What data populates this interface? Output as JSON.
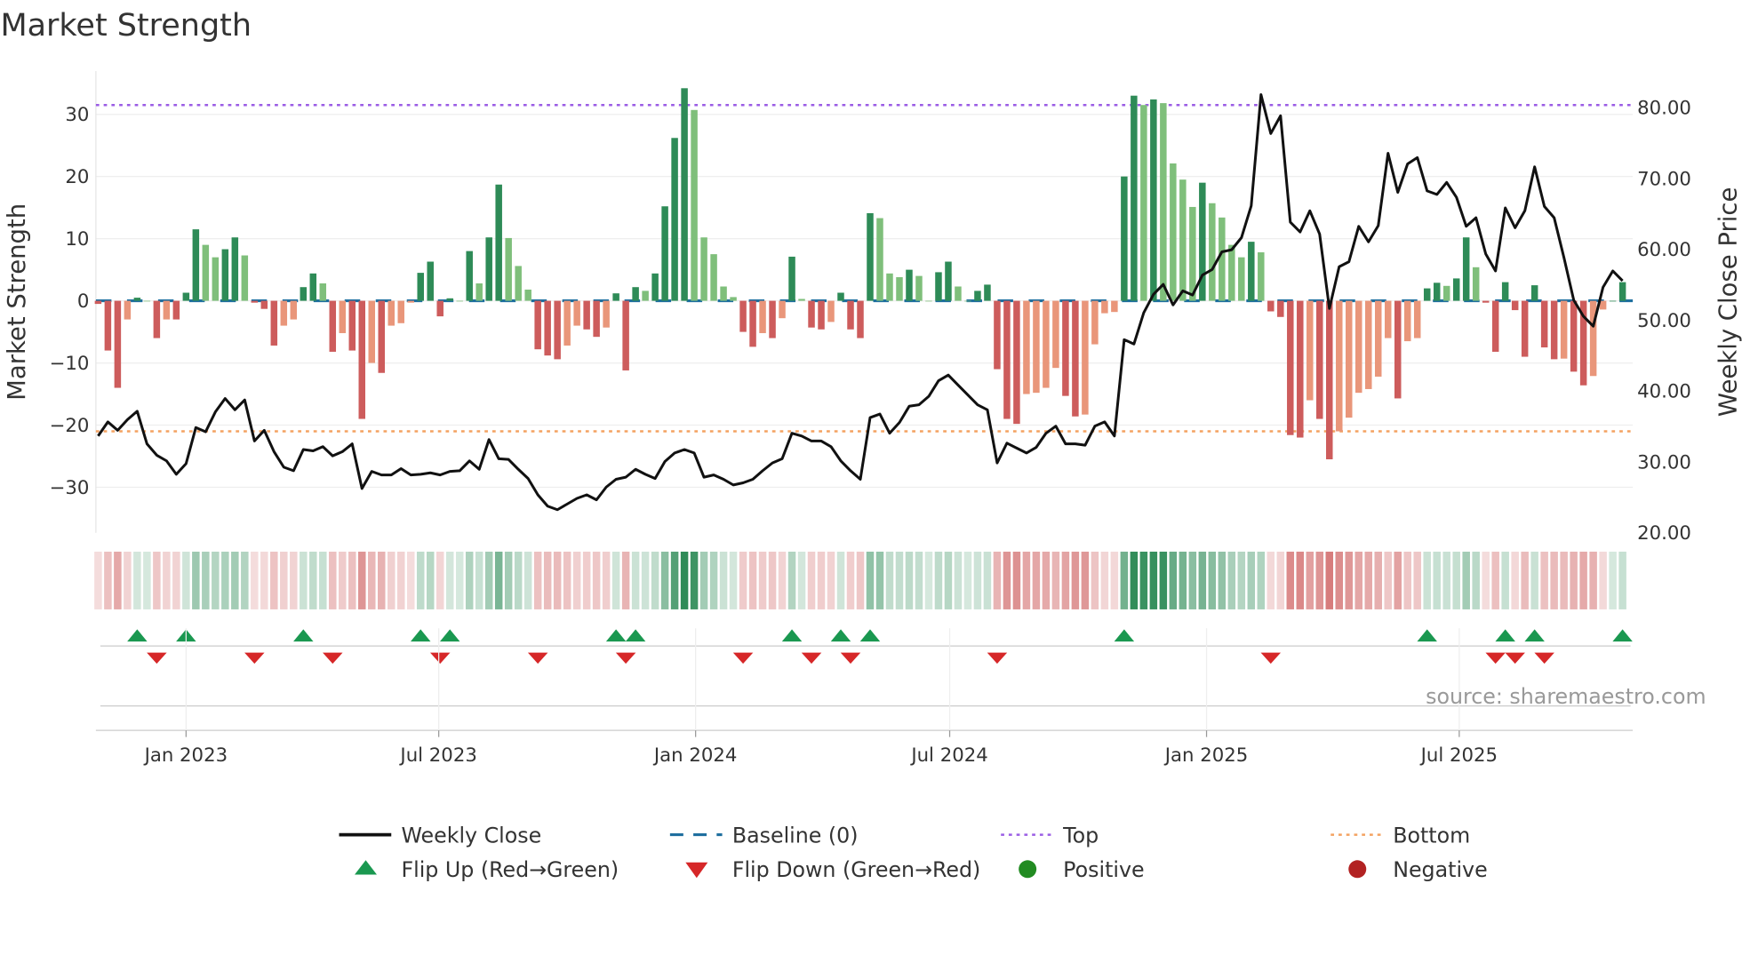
{
  "chart_data": {
    "type": "bar",
    "title": "Market Strength",
    "ylabel": "Market Strength",
    "y2label": "Weekly Close Price",
    "ylim": [
      -37,
      37
    ],
    "y2lim": [
      20,
      84
    ],
    "yticks": [
      -30,
      -20,
      -10,
      0,
      10,
      20,
      30
    ],
    "yticklabels": [
      "−30",
      "−20",
      "−10",
      "0",
      "10",
      "20",
      "30"
    ],
    "y2ticks": [
      20,
      30,
      40,
      50,
      60,
      70,
      80
    ],
    "y2ticklabels": [
      "20.00",
      "30.00",
      "40.00",
      "50.00",
      "60.00",
      "70.00",
      "80.00"
    ],
    "start_date": "2022-10-30",
    "frequency": "weekly",
    "xticks": [
      {
        "date": "2023-01-01",
        "label": "Jan 2023"
      },
      {
        "date": "2023-07-01",
        "label": "Jul 2023"
      },
      {
        "date": "2024-01-01",
        "label": "Jan 2024"
      },
      {
        "date": "2024-07-01",
        "label": "Jul 2024"
      },
      {
        "date": "2025-01-01",
        "label": "Jan 2025"
      },
      {
        "date": "2025-07-01",
        "label": "Jul 2025"
      }
    ],
    "top": 31.5,
    "bottom": -21,
    "baseline": 0,
    "strength": [
      -0.5,
      -8,
      -14,
      -3,
      0.5,
      0,
      -6,
      -3,
      -3,
      1.3,
      11.5,
      9,
      7,
      8.3,
      10.2,
      7.3,
      -0.3,
      -1.3,
      -7.2,
      -4,
      -3,
      2.2,
      4.4,
      2.8,
      -8.2,
      -5.2,
      -8,
      -19,
      -10,
      -11.6,
      -4,
      -3.6,
      -0.3,
      4.5,
      6.3,
      -2.5,
      0.4,
      0,
      8,
      2.8,
      10.2,
      18.7,
      10.1,
      5.6,
      1.8,
      -7.8,
      -8.8,
      -9.4,
      -7.2,
      -4,
      -4.6,
      -5.8,
      -4.3,
      1.2,
      -11.2,
      2.2,
      1.6,
      4.4,
      15.2,
      26.2,
      34.2,
      30.7,
      10.2,
      7.5,
      2.3,
      0.6,
      -5,
      -7.4,
      -5.2,
      -6,
      -2.8,
      7.1,
      0.3,
      -4.3,
      -4.6,
      -3.4,
      1.3,
      -4.6,
      -6,
      14.1,
      13.3,
      4.4,
      3.8,
      5,
      4,
      0,
      4.6,
      6.3,
      2.3,
      0,
      1.6,
      2.6,
      -11,
      -19,
      -19.8,
      -15,
      -14.8,
      -14,
      -10.8,
      -15.3,
      -18.6,
      -18.3,
      -7,
      -2,
      -1.8,
      20,
      33,
      31.5,
      32.4,
      31.8,
      22.1,
      19.5,
      15.1,
      19,
      15.7,
      13.4,
      9,
      7,
      9.5,
      7.8,
      -1.7,
      -2.6,
      -21.6,
      -22,
      -16,
      -19,
      -25.5,
      -21,
      -18.8,
      -14.8,
      -14.2,
      -12.2,
      -6,
      -15.7,
      -6.5,
      -6,
      2,
      2.9,
      2.4,
      3.6,
      10.2,
      5.4,
      -0.3,
      -8.2,
      3,
      -1.5,
      -9,
      2.5,
      -7.5,
      -9.4,
      -9.3,
      -11.4,
      -13.6,
      -12.1,
      -1.4,
      0,
      3
    ],
    "weekly_close": [
      33.5,
      35.5,
      34.3,
      35.8,
      37,
      32.4,
      30.8,
      30,
      28.1,
      29.6,
      34.7,
      34.1,
      36.9,
      38.8,
      37.2,
      38.6,
      32.8,
      34.3,
      31.3,
      29.1,
      28.6,
      31.6,
      31.4,
      32,
      30.7,
      31.3,
      32.4,
      26.1,
      28.5,
      28,
      28,
      28.9,
      28,
      28.1,
      28.3,
      28,
      28.5,
      28.6,
      30,
      28.8,
      33,
      30.3,
      30.2,
      28.8,
      27.5,
      25.2,
      23.6,
      23.1,
      23.9,
      24.7,
      25.2,
      24.5,
      26.3,
      27.4,
      27.7,
      28.8,
      28.1,
      27.5,
      29.9,
      31.1,
      31.6,
      31.1,
      27.7,
      28,
      27.4,
      26.6,
      26.9,
      27.4,
      28.6,
      29.7,
      30.3,
      33.9,
      33.5,
      32.8,
      32.8,
      32,
      30,
      28.6,
      27.4,
      36.1,
      36.6,
      33.9,
      35.4,
      37.7,
      37.9,
      39.1,
      41.3,
      42.1,
      40.7,
      39.3,
      37.9,
      37.2,
      29.7,
      32.5,
      31.8,
      31.1,
      31.9,
      33.9,
      34.9,
      32.4,
      32.4,
      32.2,
      34.9,
      35.5,
      33.5,
      47.1,
      46.5,
      50.9,
      53.5,
      54.9,
      52,
      54,
      53.4,
      56.2,
      57,
      59.5,
      59.8,
      61.5,
      66,
      81.7,
      76.2,
      78.7,
      63.7,
      62.3,
      65.3,
      62,
      51.5,
      57.4,
      58.1,
      63.1,
      60.9,
      63.2,
      73.4,
      67.9,
      71.9,
      72.8,
      68.1,
      67.6,
      69.3,
      67.2,
      63.1,
      64.3,
      59.2,
      56.8,
      65.7,
      62.9,
      65.3,
      71.5,
      65.9,
      64.3,
      58.7,
      52.7,
      50.4,
      49,
      54.5,
      56.8,
      55.4
    ],
    "flip_up_weeks": [
      4,
      9,
      21,
      33,
      36,
      53,
      55,
      71,
      76,
      79,
      105,
      136,
      144,
      147,
      156
    ],
    "flip_down_weeks": [
      6,
      16,
      24,
      35,
      45,
      54,
      66,
      73,
      77,
      92,
      120,
      143,
      145,
      148
    ],
    "legend": {
      "placement": "bottom",
      "items": [
        {
          "label": "Weekly Close",
          "symbol": "line"
        },
        {
          "label": "Baseline (0)",
          "symbol": "dash"
        },
        {
          "label": "Top",
          "symbol": "dot-purple"
        },
        {
          "label": "Bottom",
          "symbol": "dot-orange"
        },
        {
          "label": "Flip Up (Red→Green)",
          "symbol": "triangle-up"
        },
        {
          "label": "Flip Down (Green→Red)",
          "symbol": "triangle-down"
        },
        {
          "label": "Positive",
          "symbol": "circle-green"
        },
        {
          "label": "Negative",
          "symbol": "circle-red"
        }
      ]
    },
    "source": "source: sharemaestro.com"
  },
  "colors": {
    "pos_strong": "#2e8b57",
    "pos_weak": "#7fbf7b",
    "neg_strong": "#cd5c5c",
    "neg_weak": "#e9967a",
    "baseline": "#1f6f9f",
    "top": "#9b5de5",
    "bottom": "#f4a261",
    "flip_up": "#1a9850",
    "flip_down": "#d62728",
    "positive": "#228b22",
    "negative": "#b22222",
    "line": "#111111"
  }
}
